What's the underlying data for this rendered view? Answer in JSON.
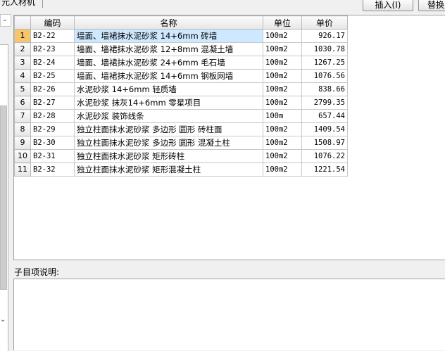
{
  "tab_label": "元人材机",
  "toolbar": {
    "insert_label": "插入(I)",
    "replace_label": "替换"
  },
  "grid": {
    "headers": {
      "code": "编码",
      "name": "名称",
      "unit": "单位",
      "price": "单价"
    },
    "rows": [
      {
        "num": "1",
        "code": "B2-22",
        "name": "墙面、墙裙抹水泥砂浆 14+6mm 砖墙",
        "unit": "100m2",
        "price": "926.17",
        "selected": true
      },
      {
        "num": "2",
        "code": "B2-23",
        "name": "墙面、墙裙抹水泥砂浆 12+8mm 混凝土墙",
        "unit": "100m2",
        "price": "1030.78"
      },
      {
        "num": "3",
        "code": "B2-24",
        "name": "墙面、墙裙抹水泥砂浆 24+6mm 毛石墙",
        "unit": "100m2",
        "price": "1267.25"
      },
      {
        "num": "4",
        "code": "B2-25",
        "name": "墙面、墙裙抹水泥砂浆 14+6mm 钢板网墙",
        "unit": "100m2",
        "price": "1076.56"
      },
      {
        "num": "5",
        "code": "B2-26",
        "name": "水泥砂浆 14+6mm 轻质墙",
        "unit": "100m2",
        "price": "838.66"
      },
      {
        "num": "6",
        "code": "B2-27",
        "name": "水泥砂浆 抹灰14+6mm 零星项目",
        "unit": "100m2",
        "price": "2799.35"
      },
      {
        "num": "7",
        "code": "B2-28",
        "name": "水泥砂浆 装饰线条",
        "unit": "100m",
        "price": "657.44"
      },
      {
        "num": "8",
        "code": "B2-29",
        "name": "独立柱面抹水泥砂浆 多边形 圆形 砖柱面",
        "unit": "100m2",
        "price": "1409.54"
      },
      {
        "num": "9",
        "code": "B2-30",
        "name": "独立柱面抹水泥砂浆 多边形 圆形 混凝土柱",
        "unit": "100m2",
        "price": "1508.97"
      },
      {
        "num": "10",
        "code": "B2-31",
        "name": "独立柱面抹水泥砂浆 矩形砖柱",
        "unit": "100m2",
        "price": "1076.22"
      },
      {
        "num": "11",
        "code": "B2-32",
        "name": "独立柱面抹水泥砂浆 矩形混凝土柱",
        "unit": "100m2",
        "price": "1221.54"
      }
    ]
  },
  "description": {
    "label": "子目项说明:",
    "text": ""
  },
  "icons": {
    "combo": "chevron-down-icon"
  },
  "colors": {
    "selected_row_bg": "#cde8ff",
    "selected_rownum_bg": "#f7c56b"
  }
}
